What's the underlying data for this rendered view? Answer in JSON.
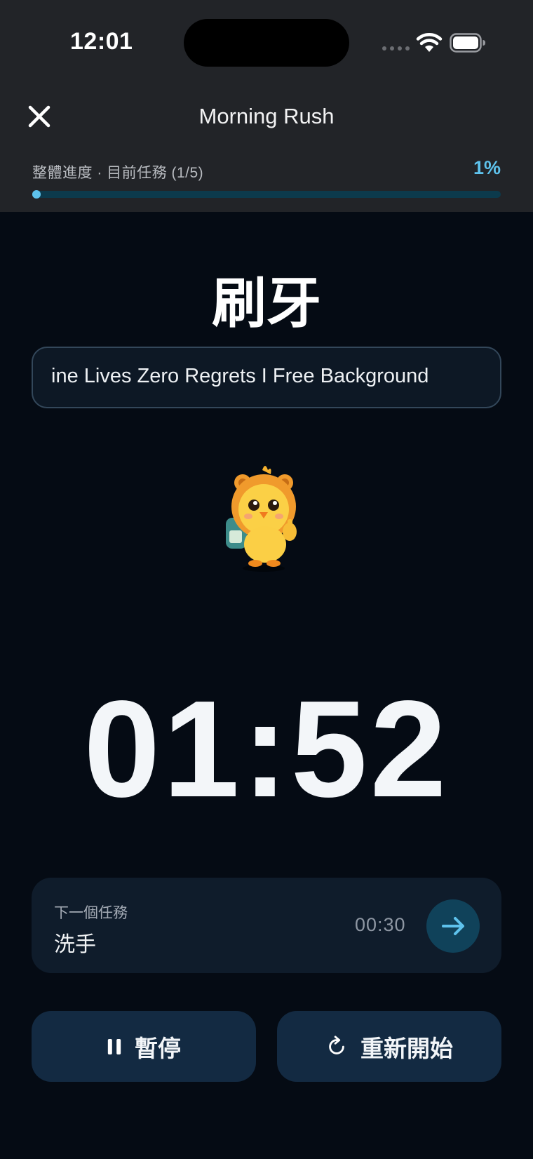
{
  "status": {
    "time": "12:01"
  },
  "nav": {
    "title": "Morning Rush"
  },
  "progress": {
    "label": "整體進度 · 目前任務 (1/5)",
    "percent_text": "1%",
    "value": 0.01
  },
  "task": {
    "title": "刷牙",
    "music_track": "ine Lives Zero Regrets I Free Background"
  },
  "timer": {
    "display": "01:52"
  },
  "next_task": {
    "label": "下一個任務",
    "name": "洗手",
    "duration": "00:30"
  },
  "controls": {
    "pause_label": "暫停",
    "restart_label": "重新開始"
  },
  "icons": [
    "close-icon",
    "wifi-icon",
    "battery-icon",
    "mascot-icon",
    "arrow-right-icon",
    "pause-icon",
    "restart-icon"
  ],
  "colors": {
    "accent": "#5ec2ec",
    "background": "#050b14",
    "header": "#222428",
    "card": "#0f1c2b",
    "button": "#132a42"
  }
}
